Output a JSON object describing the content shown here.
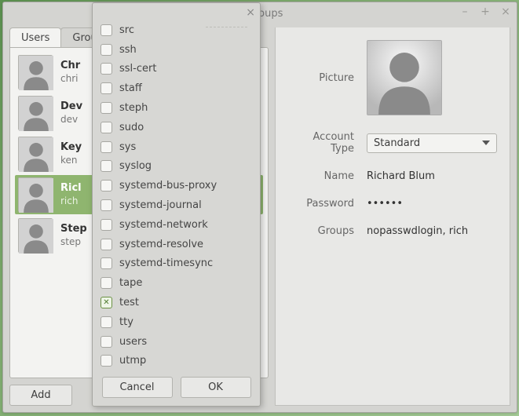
{
  "window": {
    "title_visible": "d Groups"
  },
  "tabs": {
    "users": "Users",
    "groups": "Groups"
  },
  "users": [
    {
      "name": "Chr",
      "login": "chri"
    },
    {
      "name": "Dev",
      "login": "dev"
    },
    {
      "name": "Key",
      "login": "ken"
    },
    {
      "name": "Ricl",
      "login": "rich"
    },
    {
      "name": "Step",
      "login": "step"
    }
  ],
  "selected_user_index": 3,
  "add_button": "Add",
  "details": {
    "labels": {
      "picture": "Picture",
      "account_type": "Account Type",
      "name": "Name",
      "password": "Password",
      "groups": "Groups"
    },
    "account_type_value": "Standard",
    "name_value": "Richard Blum",
    "password_value": "••••••",
    "groups_value": "nopasswdlogin, rich"
  },
  "modal": {
    "groups": [
      {
        "label": "src",
        "checked": false
      },
      {
        "label": "ssh",
        "checked": false
      },
      {
        "label": "ssl-cert",
        "checked": false
      },
      {
        "label": "staff",
        "checked": false
      },
      {
        "label": "steph",
        "checked": false
      },
      {
        "label": "sudo",
        "checked": false
      },
      {
        "label": "sys",
        "checked": false
      },
      {
        "label": "syslog",
        "checked": false
      },
      {
        "label": "systemd-bus-proxy",
        "checked": false
      },
      {
        "label": "systemd-journal",
        "checked": false
      },
      {
        "label": "systemd-network",
        "checked": false
      },
      {
        "label": "systemd-resolve",
        "checked": false
      },
      {
        "label": "systemd-timesync",
        "checked": false
      },
      {
        "label": "tape",
        "checked": false
      },
      {
        "label": "test",
        "checked": true
      },
      {
        "label": "tty",
        "checked": false
      },
      {
        "label": "users",
        "checked": false
      },
      {
        "label": "utmp",
        "checked": false
      }
    ],
    "cancel": "Cancel",
    "ok": "OK"
  }
}
